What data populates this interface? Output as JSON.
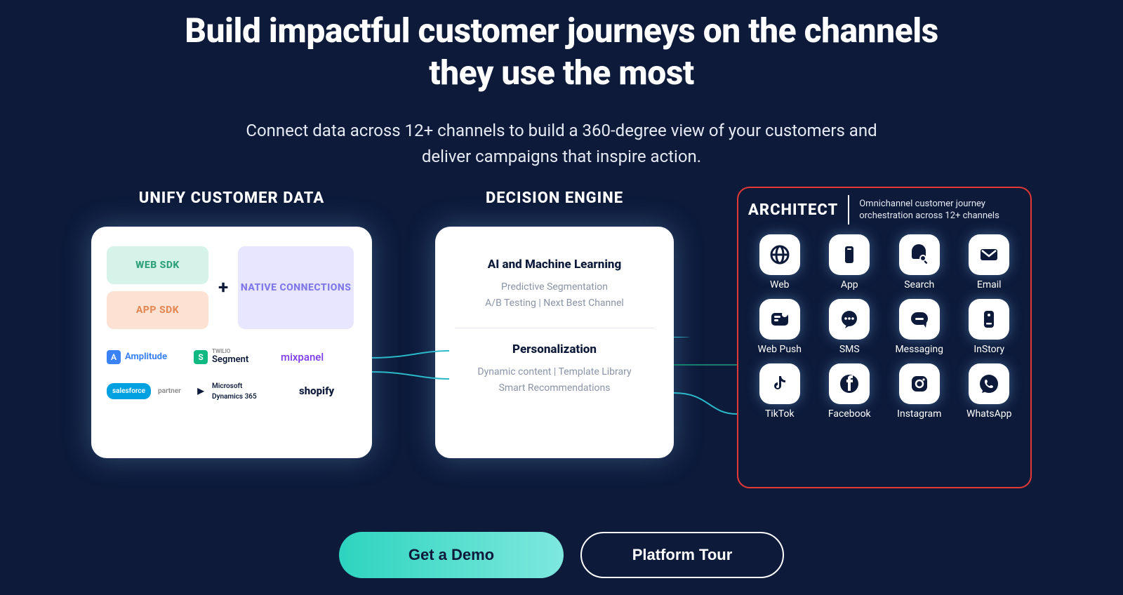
{
  "headline": "Build impactful customer journeys on the channels they use the most",
  "subhead": "Connect data across 12+ channels to build a 360-degree view of your customers and deliver campaigns that inspire action.",
  "unify": {
    "title": "UNIFY CUSTOMER DATA",
    "web_sdk": "WEB SDK",
    "app_sdk": "APP SDK",
    "plus": "+",
    "native": "NATIVE CONNECTIONS",
    "logos": {
      "amplitude": "Amplitude",
      "segment_small": "TWILIO",
      "segment": "Segment",
      "mixpanel": "mixpanel",
      "salesforce": "salesforce",
      "salesforce_tag": "partner",
      "msd_line1": "Microsoft",
      "msd_line2": "Dynamics 365",
      "shopify": "shopify"
    }
  },
  "decision": {
    "title": "DECISION ENGINE",
    "h1": "AI and Machine Learning",
    "s1a": "Predictive Segmentation",
    "s1b": "A/B Testing | Next Best Channel",
    "h2": "Personalization",
    "s2a": "Dynamic content | Template Library",
    "s2b": "Smart Recommendations"
  },
  "architect": {
    "title": "ARCHITECT",
    "desc": "Omnichannel customer journey orchestration across 12+ channels",
    "channels": [
      {
        "label": "Web",
        "icon": "globe"
      },
      {
        "label": "App",
        "icon": "phone"
      },
      {
        "label": "Search",
        "icon": "search"
      },
      {
        "label": "Email",
        "icon": "mail"
      },
      {
        "label": "Web Push",
        "icon": "push"
      },
      {
        "label": "SMS",
        "icon": "sms"
      },
      {
        "label": "Messaging",
        "icon": "msg"
      },
      {
        "label": "InStory",
        "icon": "story"
      },
      {
        "label": "TikTok",
        "icon": "tiktok"
      },
      {
        "label": "Facebook",
        "icon": "fb"
      },
      {
        "label": "Instagram",
        "icon": "ig"
      },
      {
        "label": "WhatsApp",
        "icon": "wa"
      }
    ]
  },
  "cta": {
    "primary": "Get a Demo",
    "secondary": "Platform Tour"
  }
}
